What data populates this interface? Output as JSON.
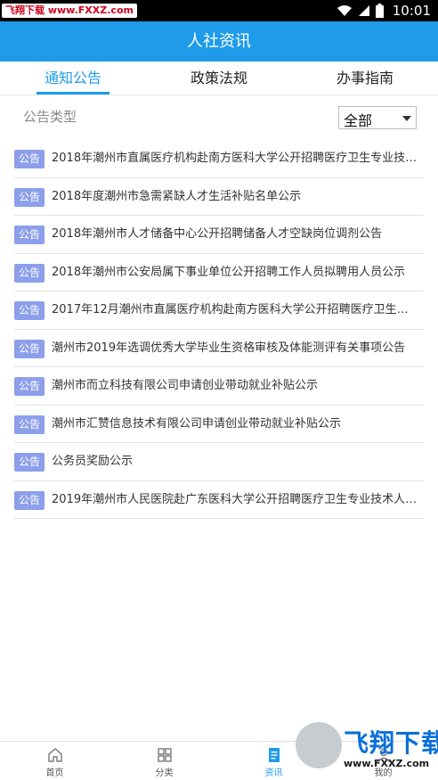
{
  "status_bar": {
    "watermark_text": "飞翔下载 www.FXXZ.com",
    "time": "10:01",
    "icons": [
      "wifi-icon",
      "signal-icon",
      "battery-icon"
    ]
  },
  "app_bar": {
    "title": "人社资讯"
  },
  "tabs": [
    {
      "label": "通知公告",
      "active": true
    },
    {
      "label": "政策法规",
      "active": false
    },
    {
      "label": "办事指南",
      "active": false
    }
  ],
  "filter": {
    "label": "公告类型",
    "selected": "全部"
  },
  "list": {
    "items": [
      {
        "badge": "公告",
        "title": "2018年潮州市直属医疗机构赴南方医科大学公开招聘医疗卫生专业技术…"
      },
      {
        "badge": "公告",
        "title": "2018年度潮州市急需紧缺人才生活补贴名单公示"
      },
      {
        "badge": "公告",
        "title": "2018年潮州市人才储备中心公开招聘储备人才空缺岗位调剂公告"
      },
      {
        "badge": "公告",
        "title": "2018年潮州市公安局属下事业单位公开招聘工作人员拟聘用人员公示"
      },
      {
        "badge": "公告",
        "title": "2017年12月潮州市直属医疗机构赴南方医科大学公开招聘医疗卫生专业…"
      },
      {
        "badge": "公告",
        "title": "潮州市2019年选调优秀大学毕业生资格审核及体能测评有关事项公告"
      },
      {
        "badge": "公告",
        "title": "潮州市而立科技有限公司申请创业带动就业补贴公示"
      },
      {
        "badge": "公告",
        "title": "潮州市汇赞信息技术有限公司申请创业带动就业补贴公示"
      },
      {
        "badge": "公告",
        "title": "公务员奖励公示"
      },
      {
        "badge": "公告",
        "title": "2019年潮州市人民医院赴广东医科大学公开招聘医疗卫生专业技术人员…"
      }
    ]
  },
  "bottom_nav": [
    {
      "label": "首页",
      "icon": "home-icon",
      "active": false
    },
    {
      "label": "分类",
      "icon": "grid-icon",
      "active": false
    },
    {
      "label": "资讯",
      "icon": "news-icon",
      "active": true
    },
    {
      "label": "我的",
      "icon": "user-icon",
      "active": false
    }
  ],
  "watermark_bottom": {
    "brand": "飞翔下载",
    "url": "www.FXXZ.com"
  },
  "colors": {
    "primary": "#1e9be9",
    "badge": "#8c9fea",
    "text": "#333333",
    "muted": "#8a8a8a"
  }
}
